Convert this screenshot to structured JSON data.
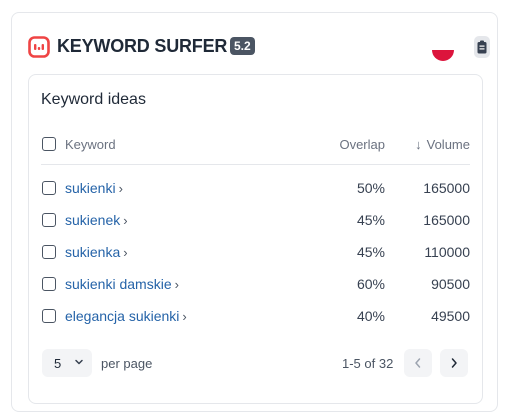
{
  "header": {
    "brand": "KEYWORD SURFER",
    "version": "5.2",
    "flag_icon": "poland-flag-icon",
    "extension_icon": "clipboard-icon"
  },
  "card": {
    "title": "Keyword ideas",
    "columns": {
      "keyword": "Keyword",
      "overlap": "Overlap",
      "volume": "Volume",
      "sort_indicator": "↓"
    },
    "rows": [
      {
        "keyword": "sukienki",
        "overlap": "50%",
        "volume": "165000"
      },
      {
        "keyword": "sukienek",
        "overlap": "45%",
        "volume": "165000"
      },
      {
        "keyword": "sukienka",
        "overlap": "45%",
        "volume": "110000"
      },
      {
        "keyword": "sukienki damskie",
        "overlap": "60%",
        "volume": "90500"
      },
      {
        "keyword": "elegancja sukienki",
        "overlap": "40%",
        "volume": "49500"
      }
    ],
    "footer": {
      "per_page_value": "5",
      "per_page_label": "per page",
      "range": "1-5 of 32"
    }
  },
  "colors": {
    "accent": "#ef4444",
    "link": "#2563a8",
    "badge": "#4b5563"
  }
}
